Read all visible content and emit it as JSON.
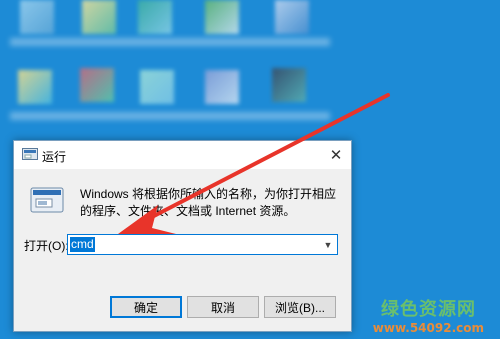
{
  "dialog": {
    "title": "运行",
    "close_glyph": "✕",
    "description": "Windows 将根据你所输入的名称，为你打开相应的程序、文件夹、文档或 Internet 资源。",
    "open_label": "打开(O):",
    "command_value": "cmd",
    "dropdown_glyph": "▼",
    "buttons": {
      "ok": "确定",
      "cancel": "取消",
      "browse": "浏览(B)..."
    }
  },
  "watermark": {
    "text_main": "绿色资源网",
    "text_sub": "www.54092.com"
  },
  "colors": {
    "desktop": "#1d8bd6",
    "accent": "#0078d7",
    "arrow": "#e8342a"
  },
  "icons": [
    "run-app-icon",
    "run-program-icon",
    "close-icon",
    "chevron-down-icon",
    "red-arrow-icon"
  ]
}
